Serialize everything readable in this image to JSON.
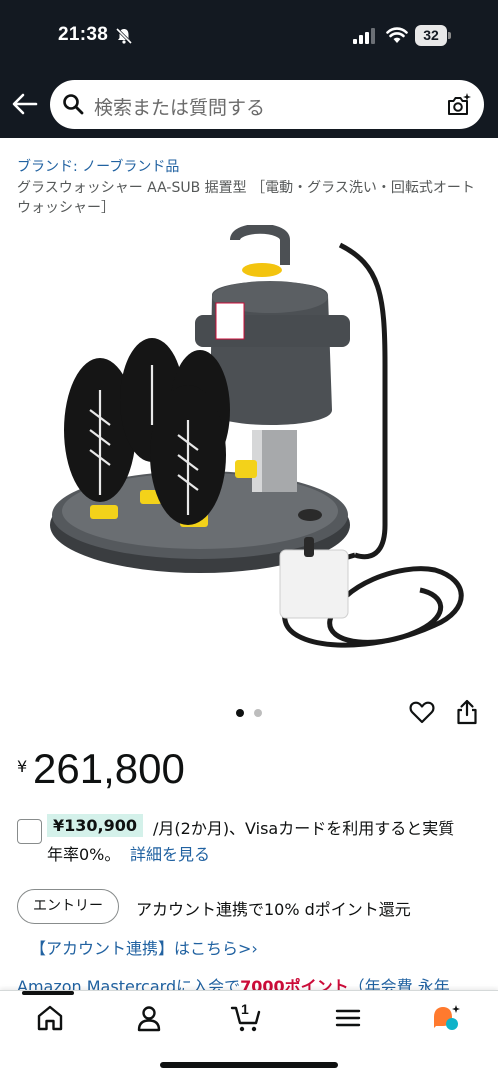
{
  "status_bar": {
    "time": "21:38",
    "battery": "32"
  },
  "search": {
    "placeholder": "検索または質問する"
  },
  "product": {
    "brand": "ブランド: ノーブランド品",
    "title": "グラスウォッシャー AA-SUB 据置型 ［電動・グラス洗い・回転式オートウォッシャー］",
    "image_count": 2,
    "active_image": 1
  },
  "price": {
    "currency": "¥",
    "value": "261,800"
  },
  "installment": {
    "amount": "¥130,900",
    "text": "/月(2か月)、Visaカードを利用すると実質",
    "text2": "年率0%。",
    "details_link": "詳細を見る"
  },
  "promo": {
    "entry_button": "エントリー",
    "points_text": "アカウント連携で10% dポイント還元",
    "account_link": "【アカウント連携】はこちら>›",
    "mastercard_prefix": "Amazon Mastercardに入会で",
    "mastercard_points": "7000ポイント",
    "mastercard_suffix": "（年会費 永年"
  },
  "bottom_nav": {
    "items": [
      "home-icon",
      "account-icon",
      "cart-icon",
      "menu-icon",
      "rufus-icon"
    ],
    "cart_count": "1"
  },
  "colors": {
    "header_bg": "#131921",
    "link": "#2162a1",
    "highlight": "#d4f1ea",
    "promo_red": "#cc0c39",
    "rufus_orange": "#ff7a2e",
    "rufus_teal": "#0fb3c9"
  }
}
